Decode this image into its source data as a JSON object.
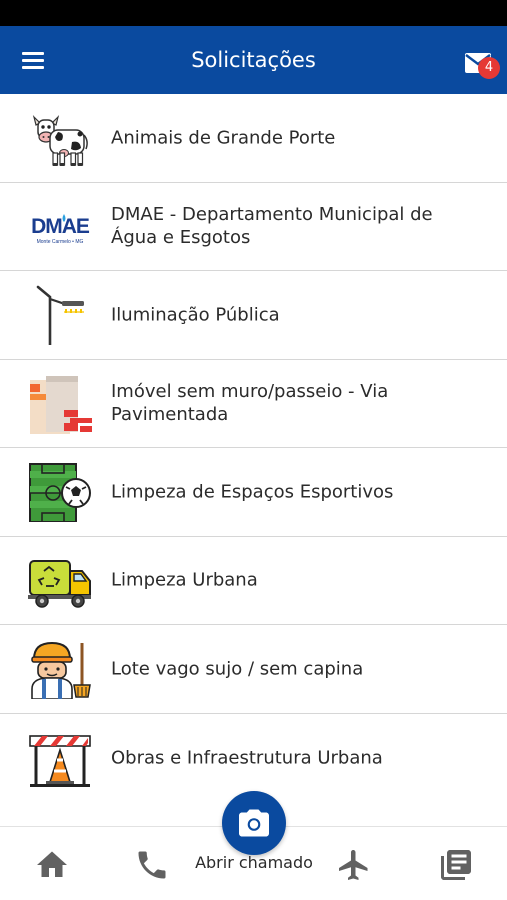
{
  "header": {
    "title": "Solicitações",
    "notification_count": "4"
  },
  "items": [
    {
      "label": "Animais de Grande Porte",
      "icon": "cow-icon"
    },
    {
      "label": "DMAE - Departamento Municipal de Água e Esgotos",
      "icon": "dmae-logo-icon"
    },
    {
      "label": "Iluminação Pública",
      "icon": "street-lamp-icon"
    },
    {
      "label": "Imóvel sem muro/passeio - Via Pavimentada",
      "icon": "wall-icon"
    },
    {
      "label": "Limpeza de Espaços Esportivos",
      "icon": "soccer-field-icon"
    },
    {
      "label": "Limpeza Urbana",
      "icon": "garbage-truck-icon"
    },
    {
      "label": "Lote vago sujo / sem capina",
      "icon": "worker-icon"
    },
    {
      "label": "Obras e Infraestrutura Urbana",
      "icon": "road-barrier-icon"
    }
  ],
  "dmae_logo": {
    "text": "DMAE",
    "subtext": "Monte Carmelo • MG"
  },
  "bottom_nav": {
    "fab_label": "Abrir chamado",
    "items": [
      "home-icon",
      "phone-icon",
      "camera-icon",
      "airplane-icon",
      "news-icon"
    ]
  },
  "colors": {
    "primary": "#0a4a9f",
    "badge": "#e53935",
    "nav_icon": "#616161"
  }
}
